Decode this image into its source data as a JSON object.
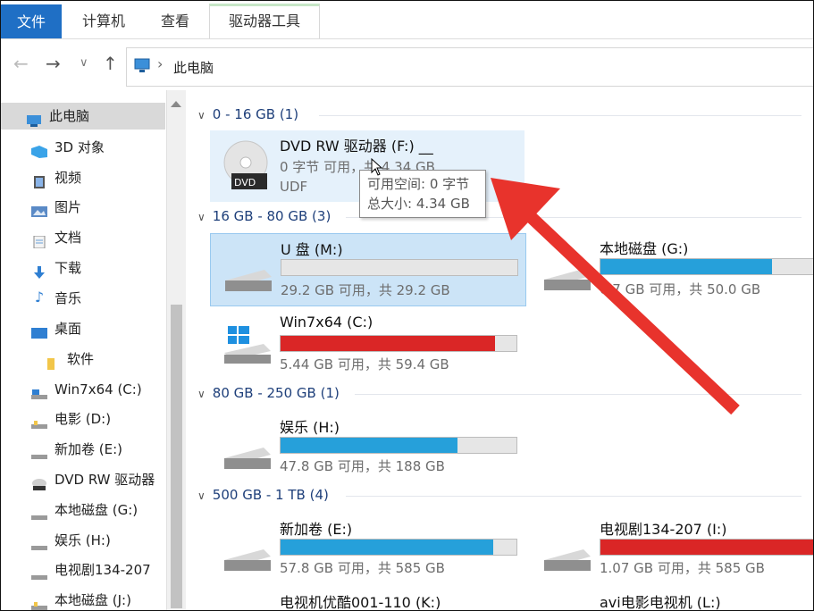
{
  "ribbon": {
    "tabs": [
      "文件",
      "计算机",
      "查看",
      "驱动器工具"
    ]
  },
  "address": {
    "path": "此电脑"
  },
  "sidebar": {
    "items": [
      {
        "label": "此电脑",
        "icon": "computer-icon"
      },
      {
        "label": "3D 对象",
        "icon": "3d-objects-icon"
      },
      {
        "label": "视频",
        "icon": "video-icon"
      },
      {
        "label": "图片",
        "icon": "pictures-icon"
      },
      {
        "label": "文档",
        "icon": "documents-icon"
      },
      {
        "label": "下载",
        "icon": "download-icon"
      },
      {
        "label": "音乐",
        "icon": "music-icon"
      },
      {
        "label": "桌面",
        "icon": "desktop-icon"
      },
      {
        "label": "软件",
        "icon": "folder-icon"
      },
      {
        "label": "Win7x64 (C:)",
        "icon": "system-drive-icon"
      },
      {
        "label": "电影 (D:)",
        "icon": "drive-icon"
      },
      {
        "label": "新加卷 (E:)",
        "icon": "drive-icon"
      },
      {
        "label": "DVD RW 驱动器",
        "icon": "dvd-drive-icon"
      },
      {
        "label": "本地磁盘 (G:)",
        "icon": "drive-icon"
      },
      {
        "label": "娱乐 (H:)",
        "icon": "drive-icon"
      },
      {
        "label": "电视剧134-207",
        "icon": "drive-icon"
      },
      {
        "label": "本地磁盘 (J:)",
        "icon": "drive-icon"
      }
    ]
  },
  "groups": [
    {
      "label": "0 - 16 GB (1)"
    },
    {
      "label": "16 GB - 80 GB (3)"
    },
    {
      "label": "80 GB - 250 GB (1)"
    },
    {
      "label": "500 GB - 1 TB (4)"
    }
  ],
  "drives": [
    {
      "name": "DVD RW 驱动器 (F:) __",
      "info": "0 字节 可用，共 4.34 GB",
      "fs": "UDF",
      "icon": "dvd-icon",
      "badge": "DVD"
    },
    {
      "name": "U 盘 (M:)",
      "info": "29.2 GB 可用，共 29.2 GB",
      "used_fraction": 0.0,
      "bar_color": "#26a0da",
      "icon": "usb-drive-icon"
    },
    {
      "name": "本地磁盘 (G:)",
      "info": "0.7 GB 可用，共 50.0 GB",
      "used_fraction": 0.8,
      "bar_color": "#26a0da",
      "icon": "drive-icon"
    },
    {
      "name": "Win7x64 (C:)",
      "info": "5.44 GB 可用，共 59.4 GB",
      "used_fraction": 0.91,
      "bar_color": "#da2626",
      "icon": "windows-drive-icon"
    },
    {
      "name": "娱乐 (H:)",
      "info": "47.8 GB 可用，共 188 GB",
      "used_fraction": 0.75,
      "bar_color": "#26a0da",
      "icon": "drive-icon"
    },
    {
      "name": "新加卷 (E:)",
      "info": "57.8 GB 可用，共 585 GB",
      "used_fraction": 0.9,
      "bar_color": "#26a0da",
      "icon": "drive-icon"
    },
    {
      "name": "电视剧134-207 (I:)",
      "info": "1.07 GB 可用，共 585 GB",
      "used_fraction": 0.99,
      "bar_color": "#da2626",
      "icon": "drive-icon"
    },
    {
      "name": "电视机优酷001-110 (K:)",
      "icon": "drive-icon"
    },
    {
      "name": "avi电影电视机 (L:)",
      "icon": "drive-icon"
    }
  ],
  "tooltip": {
    "line1": "可用空间: 0 字节",
    "line2": "总大小: 4.34 GB"
  },
  "colors": {
    "accent": "#1f6fc5",
    "bar_normal": "#26a0da",
    "bar_full": "#da2626",
    "arrow": "#e8332c"
  }
}
